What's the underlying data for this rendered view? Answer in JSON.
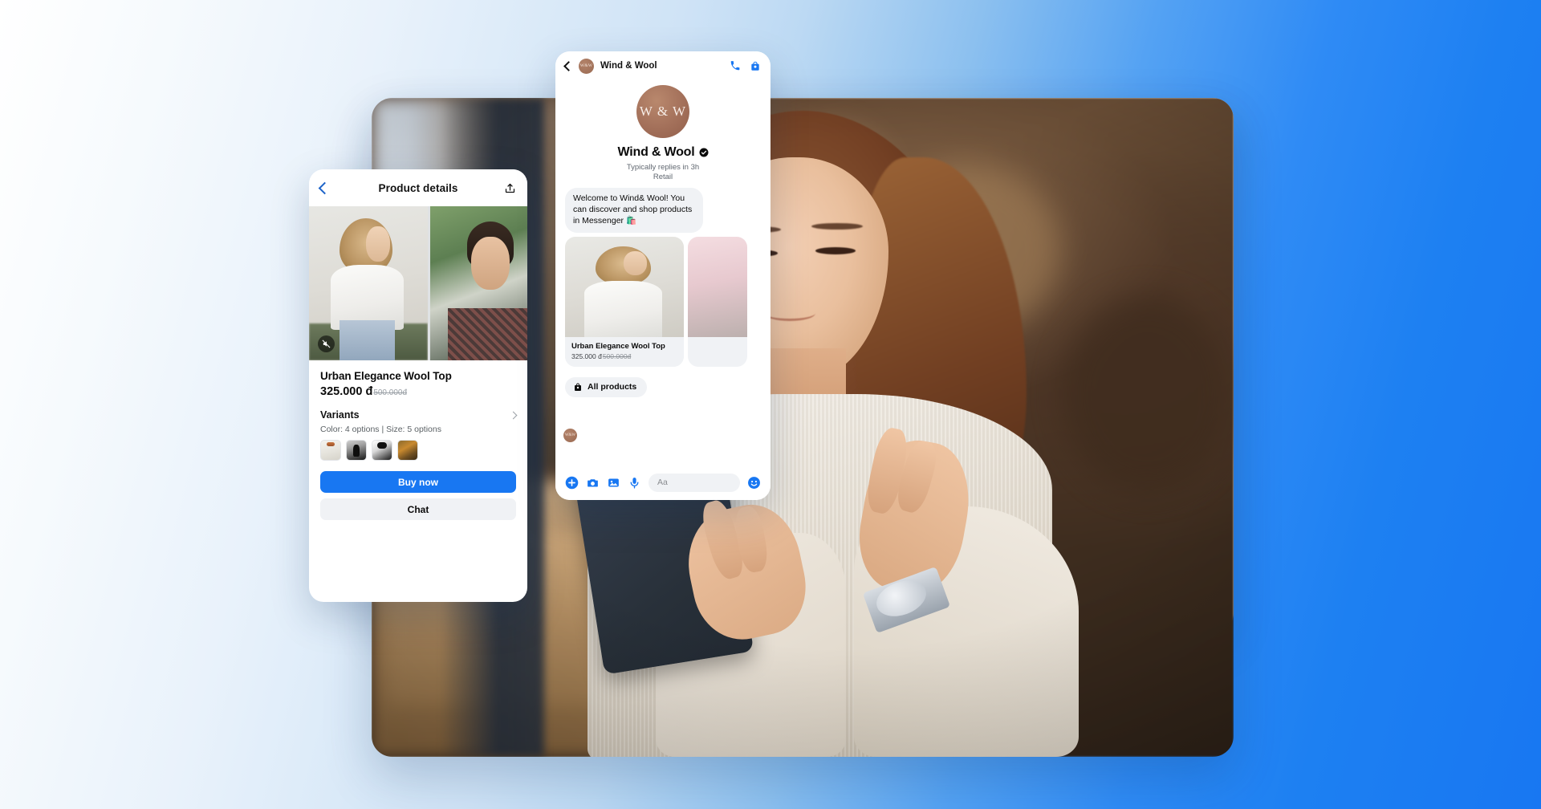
{
  "background": {
    "gradient_from": "#ffffff",
    "gradient_to": "#1877f2",
    "accent_blue": "#1877f2"
  },
  "hero_photo": {
    "alt": "Woman smiling while looking at smartphone in a cafe"
  },
  "product_details": {
    "header": {
      "back_icon": "chevron-left-icon",
      "title": "Product details",
      "share_icon": "share-icon"
    },
    "gallery": {
      "mute_icon": "mute-icon",
      "images": [
        "model-in-white-wool-top",
        "model-outdoors-in-knitwear"
      ]
    },
    "name": "Urban Elegance Wool Top",
    "price": "325.000 đ",
    "price_original": "500.000đ",
    "variants_label": "Variants",
    "variants_chevron": "chevron-right-icon",
    "options_summary": "Color: 4 options | Size: 5 options",
    "swatches": [
      "cream-white",
      "black",
      "black-white-print",
      "gold-brown"
    ],
    "buy_label": "Buy now",
    "chat_label": "Chat"
  },
  "chat": {
    "header": {
      "back_icon": "chevron-left-icon",
      "avatar_initials": "W&W",
      "title": "Wind & Wool",
      "call_icon": "phone-icon",
      "shop_icon": "shopping-bag-icon"
    },
    "profile": {
      "avatar_initials": "W & W",
      "name": "Wind & Wool",
      "verified_icon": "verified-badge-icon",
      "replies": "Typically replies in 3h",
      "category": "Retail"
    },
    "message": "Welcome to Wind& Wool! You can discover and shop products in Messenger 🛍️",
    "product_cards": [
      {
        "name": "Urban Elegance Wool Top",
        "price": "325.000 đ",
        "price_original": "500.000đ"
      },
      {
        "name": "",
        "price": "",
        "price_original": ""
      }
    ],
    "sender_avatar_initials": "W&W",
    "all_products": {
      "icon": "shopping-bag-icon",
      "label": "All products"
    },
    "composer": {
      "plus_icon": "plus-circle-icon",
      "camera_icon": "camera-icon",
      "gallery_icon": "image-icon",
      "mic_icon": "microphone-icon",
      "input_placeholder": "Aa",
      "emoji_icon": "emoji-smiley-icon"
    }
  }
}
